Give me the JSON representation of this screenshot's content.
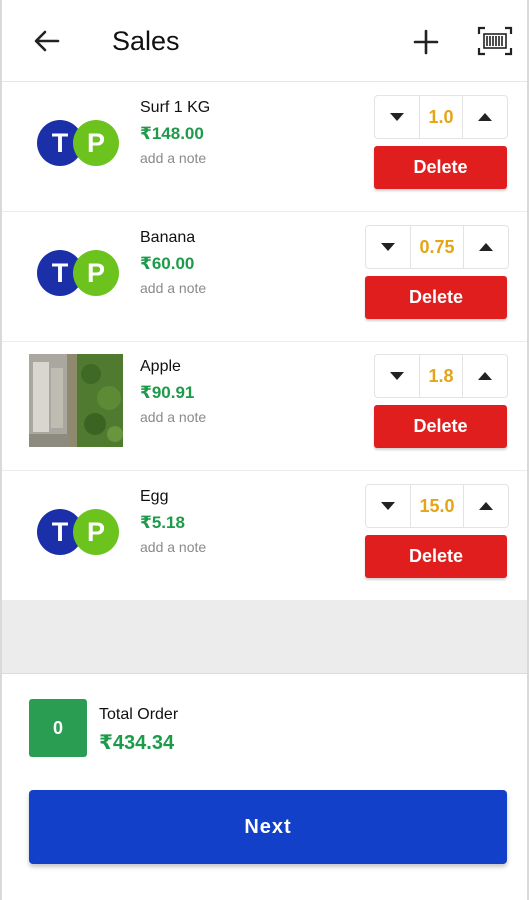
{
  "header": {
    "title": "Sales"
  },
  "items": [
    {
      "name": "Surf 1 KG",
      "price": "₹148.00",
      "note": "add a note",
      "qty": "1.0",
      "delete": "Delete",
      "thumb": "tp-logo"
    },
    {
      "name": "Banana",
      "price": "₹60.00",
      "note": "add a note",
      "qty": "0.75",
      "delete": "Delete",
      "thumb": "tp-logo"
    },
    {
      "name": "Apple",
      "price": "₹90.91",
      "note": "add a note",
      "qty": "1.8",
      "delete": "Delete",
      "thumb": "photo"
    },
    {
      "name": "Egg",
      "price": "₹5.18",
      "note": "add a note",
      "qty": "15.0",
      "delete": "Delete",
      "thumb": "tp-logo"
    }
  ],
  "logo": {
    "left_letter": "T",
    "right_letter": "P",
    "left_color": "#1a2fa8",
    "right_color": "#6cc31d"
  },
  "footer": {
    "count": "0",
    "total_label": "Total Order",
    "total_value": "₹434.34",
    "next_label": "Next"
  },
  "colors": {
    "accent_green": "#1e9b4a",
    "qty_amber": "#e6a417",
    "delete_red": "#e01e1e",
    "next_blue": "#1240c8"
  },
  "icons": {
    "back": "arrow-left-icon",
    "add": "plus-icon",
    "scan": "barcode-scan-icon"
  }
}
